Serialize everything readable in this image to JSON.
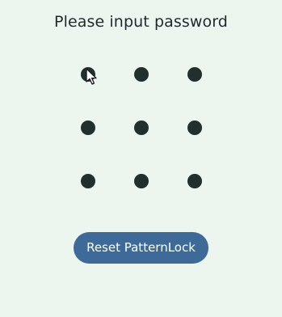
{
  "title": "Please input password",
  "pattern_grid": {
    "rows": 3,
    "cols": 3,
    "dot_color": "#22302d"
  },
  "reset_button": {
    "label": "Reset PatternLock",
    "color": "#3d6a98"
  },
  "background_color": "#edf5ef",
  "cursor_icon": "mouse-pointer"
}
